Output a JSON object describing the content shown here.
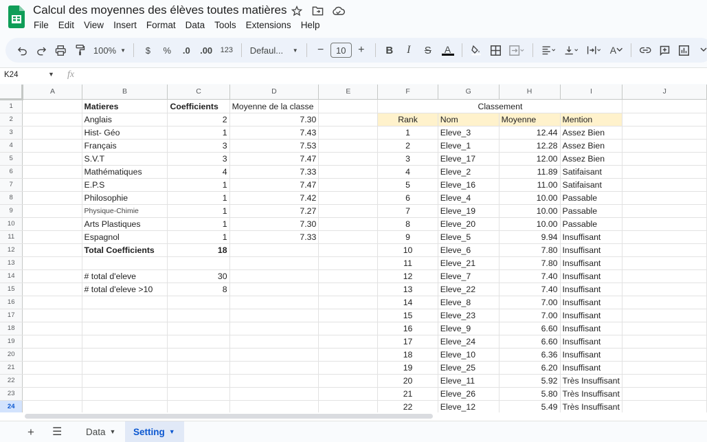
{
  "app": {
    "title": "Calcul des moyennes des élèves toutes matières",
    "menu": [
      "File",
      "Edit",
      "View",
      "Insert",
      "Format",
      "Data",
      "Tools",
      "Extensions",
      "Help"
    ]
  },
  "toolbar": {
    "zoom": "100%",
    "currency": "$",
    "percent": "%",
    "dec_decrease": ".0",
    "dec_increase": ".00",
    "num_format": "123",
    "font": "Defaul...",
    "font_size": "10",
    "minus": "−",
    "plus": "+",
    "bold": "B",
    "italic": "I",
    "strike": "S",
    "text_color": "A",
    "text_rotate": "A"
  },
  "formula_bar": {
    "cell_ref": "K24",
    "fx": "fx"
  },
  "grid": {
    "columns": [
      "A",
      "B",
      "C",
      "D",
      "E",
      "F",
      "G",
      "H",
      "I",
      "J"
    ],
    "rows": [
      [
        "",
        "Matieres",
        "Coefficients",
        "Moyenne de la classe",
        "",
        "Classement",
        "",
        "",
        "",
        ""
      ],
      [
        "",
        "Anglais",
        "2",
        "7.30",
        "",
        "Rank",
        "Nom",
        "Moyenne",
        "Mention",
        ""
      ],
      [
        "",
        "Hist- Géo",
        "1",
        "7.43",
        "",
        "1",
        "Eleve_3",
        "12.44",
        "Assez Bien",
        ""
      ],
      [
        "",
        "Français",
        "3",
        "7.53",
        "",
        "2",
        "Eleve_1",
        "12.28",
        "Assez Bien",
        ""
      ],
      [
        "",
        "S.V.T",
        "3",
        "7.47",
        "",
        "3",
        "Eleve_17",
        "12.00",
        "Assez Bien",
        ""
      ],
      [
        "",
        "Mathématiques",
        "4",
        "7.33",
        "",
        "4",
        "Eleve_2",
        "11.89",
        "Satifaisant",
        ""
      ],
      [
        "",
        "E.P.S",
        "1",
        "7.47",
        "",
        "5",
        "Eleve_16",
        "11.00",
        "Satifaisant",
        ""
      ],
      [
        "",
        "Philosophie",
        "1",
        "7.42",
        "",
        "6",
        "Eleve_4",
        "10.00",
        "Passable",
        ""
      ],
      [
        "",
        "Physique-Chimie",
        "1",
        "7.27",
        "",
        "7",
        "Eleve_19",
        "10.00",
        "Passable",
        ""
      ],
      [
        "",
        "Arts Plastiques",
        "1",
        "7.30",
        "",
        "8",
        "Eleve_20",
        "10.00",
        "Passable",
        ""
      ],
      [
        "",
        "Espagnol",
        "1",
        "7.33",
        "",
        "9",
        "Eleve_5",
        "9.94",
        "Insuffisant",
        ""
      ],
      [
        "",
        "Total Coefficients",
        "18",
        "",
        "",
        "10",
        "Eleve_6",
        "7.80",
        "Insuffisant",
        ""
      ],
      [
        "",
        "",
        "",
        "",
        "",
        "11",
        "Eleve_21",
        "7.80",
        "Insuffisant",
        ""
      ],
      [
        "",
        "# total d'eleve",
        "30",
        "",
        "",
        "12",
        "Eleve_7",
        "7.40",
        "Insuffisant",
        ""
      ],
      [
        "",
        "# total d'eleve >10",
        "8",
        "",
        "",
        "13",
        "Eleve_22",
        "7.40",
        "Insuffisant",
        ""
      ],
      [
        "",
        "",
        "",
        "",
        "",
        "14",
        "Eleve_8",
        "7.00",
        "Insuffisant",
        ""
      ],
      [
        "",
        "",
        "",
        "",
        "",
        "15",
        "Eleve_23",
        "7.00",
        "Insuffisant",
        ""
      ],
      [
        "",
        "",
        "",
        "",
        "",
        "16",
        "Eleve_9",
        "6.60",
        "Insuffisant",
        ""
      ],
      [
        "",
        "",
        "",
        "",
        "",
        "17",
        "Eleve_24",
        "6.60",
        "Insuffisant",
        ""
      ],
      [
        "",
        "",
        "",
        "",
        "",
        "18",
        "Eleve_10",
        "6.36",
        "Insuffisant",
        ""
      ],
      [
        "",
        "",
        "",
        "",
        "",
        "19",
        "Eleve_25",
        "6.20",
        "Insuffisant",
        ""
      ],
      [
        "",
        "",
        "",
        "",
        "",
        "20",
        "Eleve_11",
        "5.92",
        "Très Insuffisant",
        ""
      ],
      [
        "",
        "",
        "",
        "",
        "",
        "21",
        "Eleve_26",
        "5.80",
        "Très Insuffisant",
        ""
      ],
      [
        "",
        "",
        "",
        "",
        "",
        "22",
        "Eleve_12",
        "5.49",
        "Très Insuffisant",
        ""
      ]
    ],
    "selected_row": 24
  },
  "sheets": {
    "tabs": [
      "Data",
      "Setting"
    ],
    "active": "Setting"
  },
  "colors": {
    "header_highlight": "#fff2cc",
    "active_tab": "#0b57d0",
    "toolbar_bg": "#edf2fa"
  },
  "icons": [
    "sheets-logo-icon",
    "star-icon",
    "move-to-folder-icon",
    "cloud-saved-icon",
    "undo-icon",
    "redo-icon",
    "print-icon",
    "paint-format-icon",
    "fill-color-icon",
    "borders-icon",
    "merge-cells-icon",
    "align-left-icon",
    "vertical-align-icon",
    "text-wrap-icon",
    "text-rotation-icon",
    "insert-link-icon",
    "insert-comment-icon",
    "insert-chart-icon",
    "add-sheet-icon",
    "all-sheets-icon"
  ]
}
